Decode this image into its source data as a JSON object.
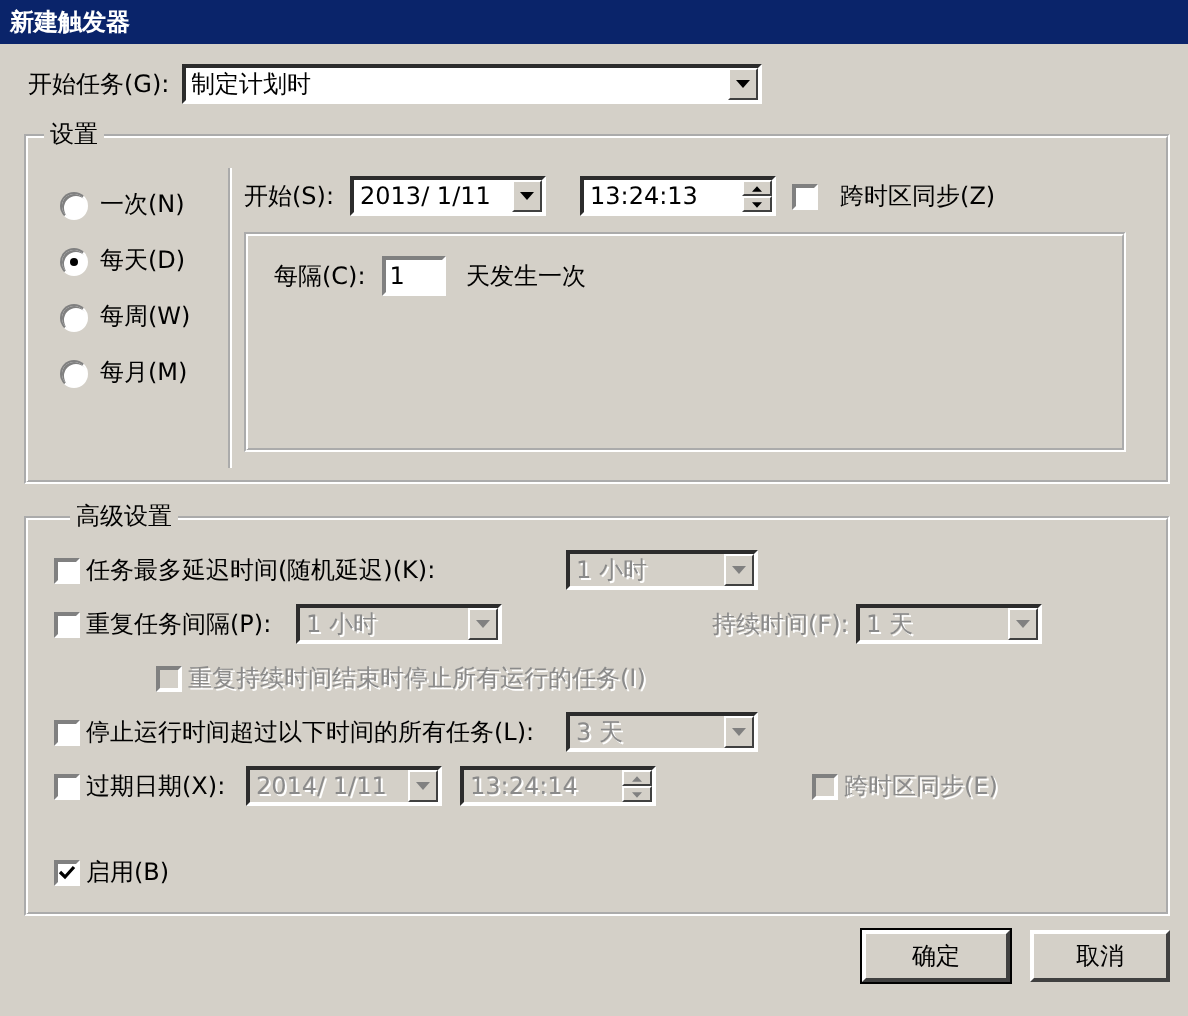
{
  "window": {
    "title": "新建触发器"
  },
  "start_task": {
    "label": "开始任务(G):",
    "value": "制定计划时"
  },
  "settings": {
    "title": "设置",
    "schedules": [
      {
        "label": "一次(N)",
        "selected": false
      },
      {
        "label": "每天(D)",
        "selected": true
      },
      {
        "label": "每周(W)",
        "selected": false
      },
      {
        "label": "每月(M)",
        "selected": false
      }
    ],
    "start": {
      "label": "开始(S):",
      "date": "2013/ 1/11",
      "time": "13:24:13",
      "sync_label": "跨时区同步(Z)",
      "sync_checked": false
    },
    "interval": {
      "label": "每隔(C):",
      "value": "1",
      "suffix": "天发生一次"
    }
  },
  "advanced": {
    "title": "高级设置",
    "delay": {
      "label": "任务最多延迟时间(随机延迟)(K):",
      "checked": false,
      "value": "1 小时",
      "disabled": true
    },
    "repeat": {
      "label": "重复任务间隔(P):",
      "checked": false,
      "value": "1 小时",
      "disabled": true,
      "duration_label": "持续时间(F):",
      "duration_value": "1 天"
    },
    "stop_at_end": {
      "label": "重复持续时间结束时停止所有运行的任务(I)",
      "checked": false,
      "disabled": true
    },
    "stop_long": {
      "label": "停止运行时间超过以下时间的所有任务(L):",
      "checked": false,
      "value": "3 天",
      "disabled": true
    },
    "expire": {
      "label": "过期日期(X):",
      "checked": false,
      "date": "2014/ 1/11",
      "time": "13:24:14",
      "disabled": true,
      "sync_label": "跨时区同步(E)",
      "sync_checked": false
    },
    "enabled": {
      "label": "启用(B)",
      "checked": true
    }
  },
  "buttons": [
    {
      "label": "确定",
      "default": true
    },
    {
      "label": "取消",
      "default": false
    }
  ]
}
